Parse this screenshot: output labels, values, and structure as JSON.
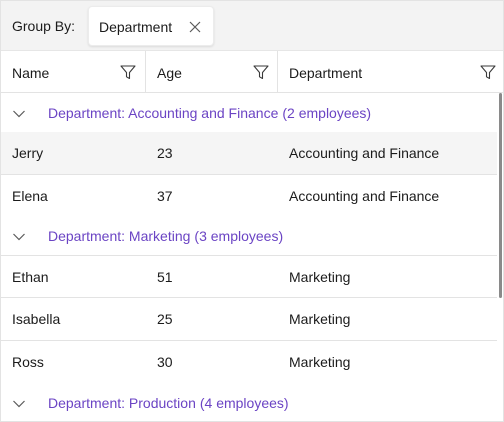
{
  "groupby_panel": {
    "label": "Group By:",
    "chips": [
      {
        "label": "Department",
        "close_icon": "close-icon"
      }
    ]
  },
  "columns": [
    {
      "label": "Name",
      "icon": "filter-icon"
    },
    {
      "label": "Age",
      "icon": "filter-icon"
    },
    {
      "label": "Department",
      "icon": "filter-icon"
    }
  ],
  "groups": [
    {
      "header": "Department: Accounting and Finance",
      "count": "(2 employees)",
      "rows": [
        {
          "name": "Jerry",
          "age": "23",
          "department": "Accounting and Finance"
        },
        {
          "name": "Elena",
          "age": "37",
          "department": "Accounting and Finance"
        }
      ]
    },
    {
      "header": "Department: Marketing",
      "count": "(3 employees)",
      "rows": [
        {
          "name": "Ethan",
          "age": "51",
          "department": "Marketing"
        },
        {
          "name": "Isabella",
          "age": "25",
          "department": "Marketing"
        },
        {
          "name": "Ross",
          "age": "30",
          "department": "Marketing"
        }
      ]
    },
    {
      "header": "Department: Production",
      "count": "(4 employees)",
      "rows": []
    }
  ],
  "colors": {
    "group_header_text": "#6b44c4",
    "groupby_background": "#f3f3f3",
    "row_hover": "#f5f5f5",
    "grid_lines": "#e3e3e3"
  }
}
